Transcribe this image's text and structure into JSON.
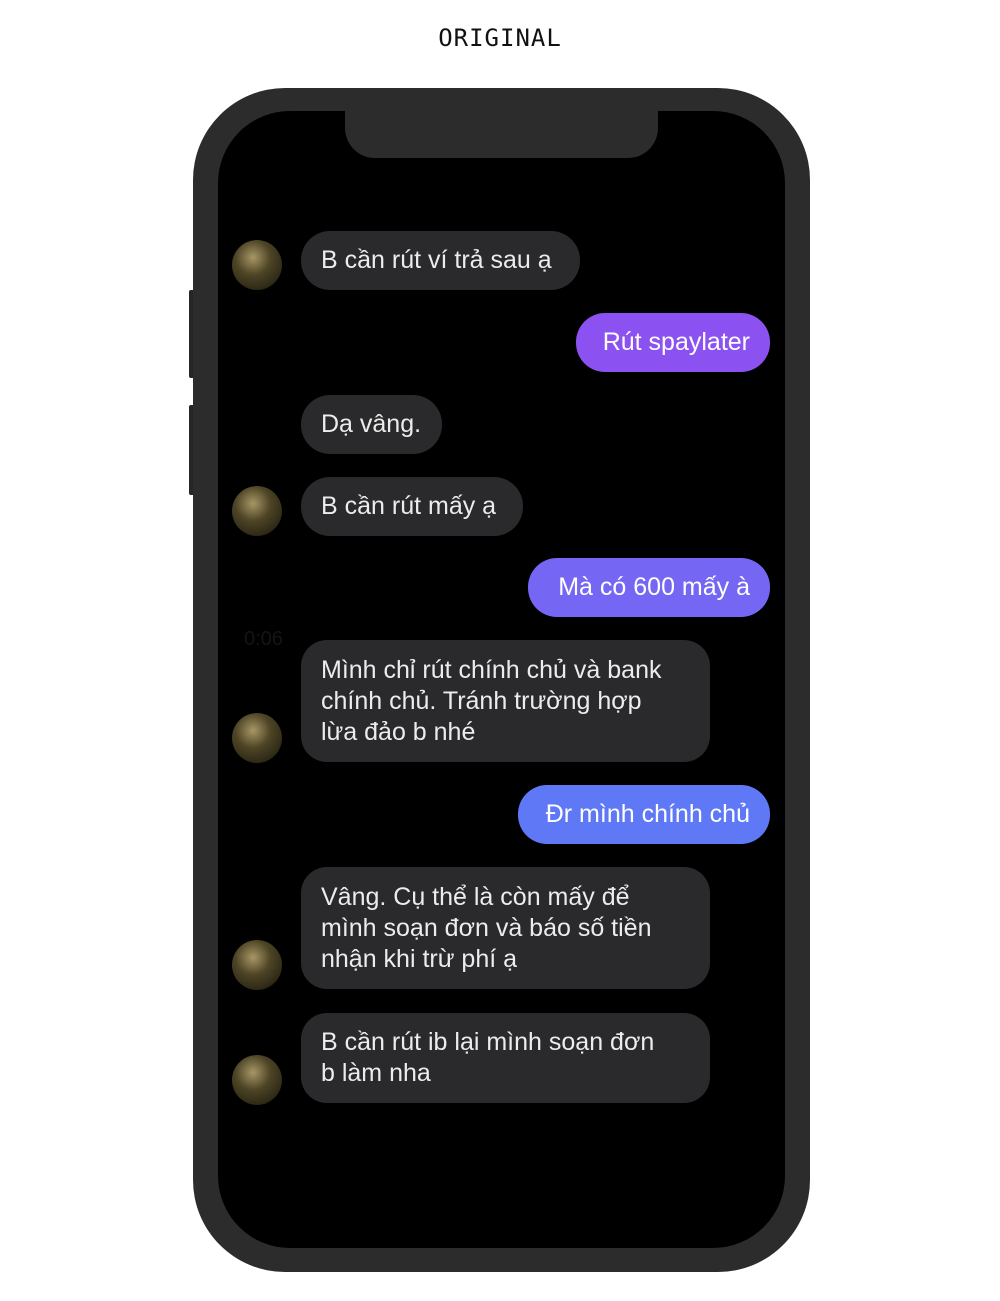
{
  "caption": "ORIGINAL",
  "chat": {
    "background_ghost_text": "0:06",
    "messages": [
      {
        "sender": "other",
        "text": "B cần rút ví trả sau ạ"
      },
      {
        "sender": "me",
        "text": "Rút spaylater"
      },
      {
        "sender": "other",
        "text": "Dạ vâng."
      },
      {
        "sender": "other",
        "text": "B cần rút mấy ạ"
      },
      {
        "sender": "me",
        "text": "Mà có 600 mấy à"
      },
      {
        "sender": "other",
        "text": "Mình chỉ rút chính chủ và bank\nchính chủ. Tránh trường hợp\nlừa đảo b nhé"
      },
      {
        "sender": "me",
        "text": "Đr mình chính chủ"
      },
      {
        "sender": "other",
        "text": "Vâng. Cụ thể là còn mấy để\nmình soạn đơn và báo số tiền\nnhận khi trừ phí ạ"
      },
      {
        "sender": "other",
        "text": "B cần rút ib lại mình soạn đơn\nb làm nha"
      }
    ]
  },
  "colors": {
    "phone_frame": "#2c2c2c",
    "screen": "#000000",
    "incoming_bubble": "#2a2a2c",
    "outgoing_gradient_top": "#9b4cf0",
    "outgoing_gradient_bottom": "#5a7cf7"
  },
  "icons": {
    "avatar": "golden-sphere-avatar"
  }
}
